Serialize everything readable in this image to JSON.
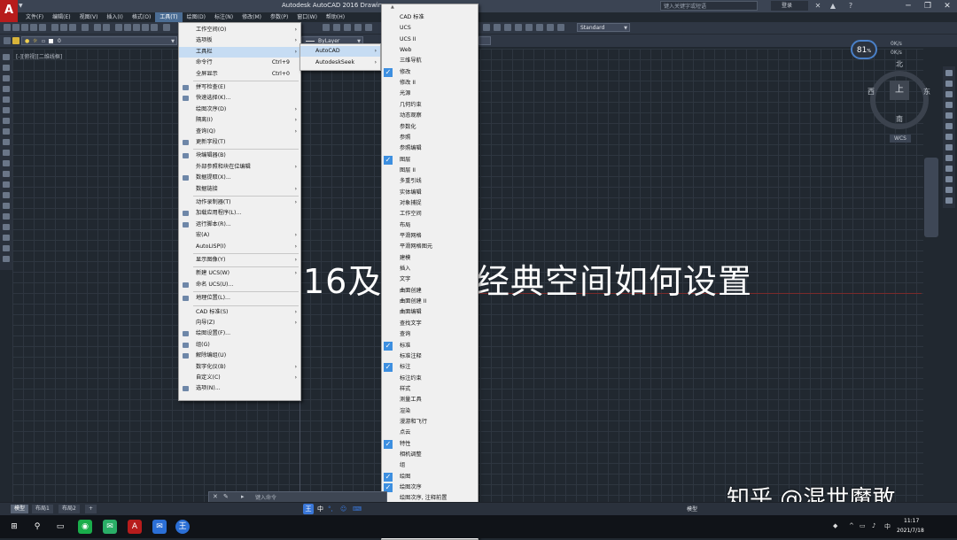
{
  "window": {
    "title": "Autodesk AutoCAD 2016    Drawin",
    "search_placeholder": "键入关键字或短语",
    "user_label": "登录",
    "logo_letter": "A",
    "controls": [
      "─",
      "❐",
      "✕"
    ]
  },
  "menubar": {
    "items": [
      "文件(F)",
      "编辑(E)",
      "视图(V)",
      "插入(I)",
      "格式(O)",
      "工具(T)",
      "绘图(D)",
      "标注(N)",
      "修改(M)",
      "参数(P)",
      "窗口(W)",
      "帮助(H)"
    ],
    "active": "工具(T)"
  },
  "toolbar": {
    "layer_value": "0",
    "linetype_value": "ByLayer",
    "style_value": "Standard"
  },
  "viewport_label": "[-][俯视][二维线框]",
  "viewcube": {
    "top_face": "上",
    "north": "北",
    "south": "南",
    "west": "西",
    "east": "东",
    "ucs_label": "WCS"
  },
  "gauge": {
    "value": "81",
    "unit": "%",
    "net_up": "0K/s",
    "net_down": "0K/s"
  },
  "tools_menu": {
    "items": [
      {
        "label": "工作空间(O)",
        "sub": true
      },
      {
        "label": "选项板",
        "sub": true
      },
      {
        "label": "工具栏",
        "sub": true,
        "highlight": true
      },
      {
        "label": "命令行",
        "shortcut": "Ctrl+9"
      },
      {
        "label": "全屏显示",
        "shortcut": "Ctrl+0"
      },
      {
        "sep": true
      },
      {
        "label": "拼写检查(E)",
        "icon": true
      },
      {
        "label": "快速选择(K)...",
        "icon": true
      },
      {
        "label": "绘图次序(D)",
        "sub": true
      },
      {
        "label": "隔离(I)",
        "sub": true
      },
      {
        "label": "查询(Q)",
        "sub": true
      },
      {
        "label": "更新字段(T)",
        "icon": true
      },
      {
        "sep": true
      },
      {
        "label": "块编辑器(B)",
        "icon": true
      },
      {
        "label": "外部参照和块在位编辑",
        "sub": true
      },
      {
        "label": "数据提取(X)...",
        "icon": true
      },
      {
        "label": "数据链接",
        "sub": true
      },
      {
        "sep": true
      },
      {
        "label": "动作录制器(T)",
        "sub": true
      },
      {
        "label": "加载应用程序(L)...",
        "icon": true
      },
      {
        "label": "运行脚本(R)...",
        "icon": true
      },
      {
        "label": "宏(A)",
        "sub": true
      },
      {
        "label": "AutoLISP(I)",
        "sub": true
      },
      {
        "sep": true
      },
      {
        "label": "显示图像(Y)",
        "sub": true
      },
      {
        "sep": true
      },
      {
        "label": "新建 UCS(W)",
        "sub": true
      },
      {
        "label": "命名 UCS(U)...",
        "icon": true
      },
      {
        "sep": true
      },
      {
        "label": "地理位置(L)...",
        "icon": true
      },
      {
        "sep": true
      },
      {
        "label": "CAD 标准(S)",
        "sub": true
      },
      {
        "label": "向导(Z)",
        "sub": true
      },
      {
        "label": "绘图设置(F)...",
        "icon": true
      },
      {
        "label": "组(G)",
        "icon": true
      },
      {
        "label": "解除编组(U)",
        "icon": true
      },
      {
        "label": "数字化仪(B)",
        "sub": true
      },
      {
        "label": "自定义(C)",
        "sub": true
      },
      {
        "label": "选项(N)...",
        "icon": true
      }
    ]
  },
  "toolbar_submenu": {
    "items": [
      {
        "label": "AutoCAD",
        "highlight": true
      },
      {
        "label": "AutodeskSeek"
      }
    ]
  },
  "autocad_toolbars": {
    "scroll_up": "▲",
    "scroll_down": "▼",
    "items": [
      {
        "label": "CAD 标准",
        "checked": false
      },
      {
        "label": "UCS",
        "checked": false
      },
      {
        "label": "UCS II",
        "checked": false
      },
      {
        "label": "Web",
        "checked": false
      },
      {
        "label": "三维导航",
        "checked": false
      },
      {
        "label": "修改",
        "checked": true
      },
      {
        "label": "修改 II",
        "checked": false
      },
      {
        "label": "光源",
        "checked": false
      },
      {
        "label": "几何约束",
        "checked": false
      },
      {
        "label": "动态观察",
        "checked": false
      },
      {
        "label": "参数化",
        "checked": false
      },
      {
        "label": "参照",
        "checked": false
      },
      {
        "label": "参照编辑",
        "checked": false
      },
      {
        "label": "图层",
        "checked": true
      },
      {
        "label": "图层 II",
        "checked": false
      },
      {
        "label": "多重引线",
        "checked": false
      },
      {
        "label": "实体编辑",
        "checked": false
      },
      {
        "label": "对象捕捉",
        "checked": false
      },
      {
        "label": "工作空间",
        "checked": false
      },
      {
        "label": "布局",
        "checked": false
      },
      {
        "label": "平滑网格",
        "checked": false
      },
      {
        "label": "平滑网格图元",
        "checked": false
      },
      {
        "label": "建模",
        "checked": false
      },
      {
        "label": "插入",
        "checked": false
      },
      {
        "label": "文字",
        "checked": false
      },
      {
        "label": "曲面创建",
        "checked": false
      },
      {
        "label": "曲面创建 II",
        "checked": false
      },
      {
        "label": "曲面编辑",
        "checked": false
      },
      {
        "label": "查找文字",
        "checked": false
      },
      {
        "label": "查询",
        "checked": false
      },
      {
        "label": "标准",
        "checked": true
      },
      {
        "label": "标准注释",
        "checked": false
      },
      {
        "label": "标注",
        "checked": true
      },
      {
        "label": "标注约束",
        "checked": false
      },
      {
        "label": "样式",
        "checked": false
      },
      {
        "label": "测量工具",
        "checked": false
      },
      {
        "label": "渲染",
        "checked": false
      },
      {
        "label": "漫游和飞行",
        "checked": false
      },
      {
        "label": "点云",
        "checked": false
      },
      {
        "label": "特性",
        "checked": true
      },
      {
        "label": "相机调整",
        "checked": false
      },
      {
        "label": "组",
        "checked": false
      },
      {
        "label": "绘图",
        "checked": true
      },
      {
        "label": "绘图次序",
        "checked": true
      },
      {
        "label": "绘图次序, 注释前置",
        "checked": false
      },
      {
        "label": "缩放",
        "checked": false
      },
      {
        "label": "视口",
        "checked": false
      }
    ]
  },
  "overlay": {
    "title_part1": "16及",
    "title_part2": "经典空间如何设置",
    "watermark": "知乎 @混世魔敢"
  },
  "command_line": {
    "placeholder": "键入命令"
  },
  "layout_tabs": [
    "模型",
    "布局1",
    "布局2",
    "+"
  ],
  "status": {
    "model_label": "模型"
  },
  "ime": {
    "items": [
      "中",
      "°,",
      "☺",
      "⌨"
    ]
  },
  "taskbar": {
    "time": "11:17",
    "date": "2021/7/18",
    "ime_indicator": "中"
  },
  "colors": {
    "accent": "#3d8fe0",
    "menu_highlight": "#c6dcf3",
    "canvas": "#212830",
    "logo": "#b71c1c"
  }
}
